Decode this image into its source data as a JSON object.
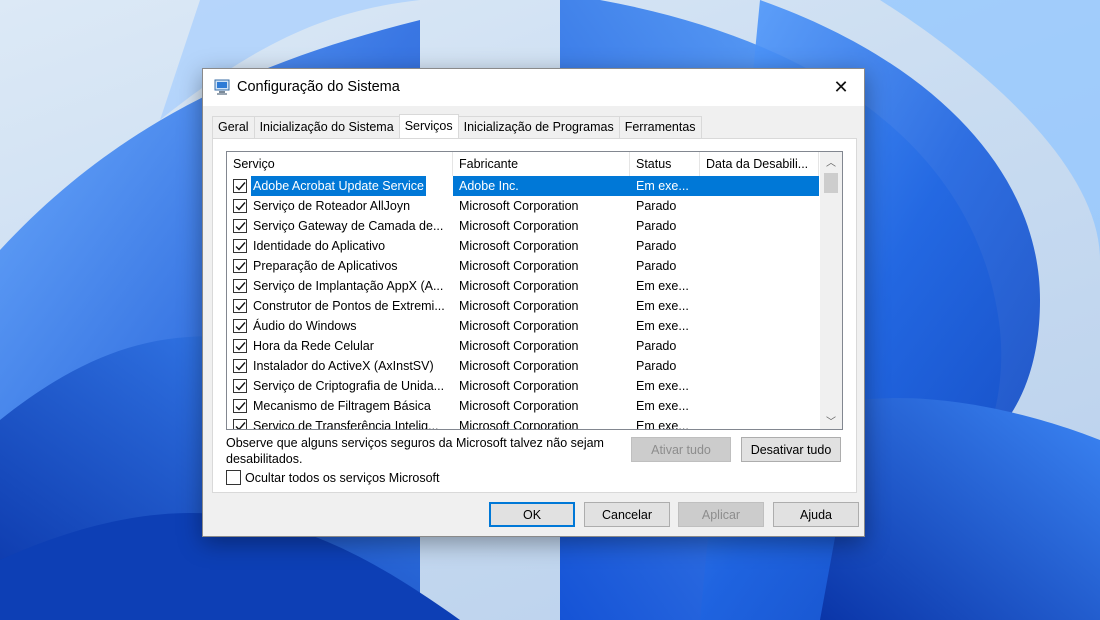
{
  "window": {
    "title": "Configuração do Sistema",
    "close_glyph": "✕",
    "icon": "msconfig-computer-icon"
  },
  "tabs": [
    {
      "label": "Geral",
      "active": false
    },
    {
      "label": "Inicialização do Sistema",
      "active": false
    },
    {
      "label": "Serviços",
      "active": true
    },
    {
      "label": "Inicialização de Programas",
      "active": false
    },
    {
      "label": "Ferramentas",
      "active": false
    }
  ],
  "services": {
    "columns": [
      "Serviço",
      "Fabricante",
      "Status",
      "Data da Desabili..."
    ],
    "rows": [
      {
        "name": "Adobe Acrobat Update Service",
        "manufacturer": "Adobe Inc.",
        "status": "Em exe...",
        "date": "",
        "checked": true,
        "selected": true
      },
      {
        "name": "Serviço de Roteador AllJoyn",
        "manufacturer": "Microsoft Corporation",
        "status": "Parado",
        "date": "",
        "checked": true,
        "selected": false
      },
      {
        "name": "Serviço Gateway de Camada de...",
        "manufacturer": "Microsoft Corporation",
        "status": "Parado",
        "date": "",
        "checked": true,
        "selected": false
      },
      {
        "name": "Identidade do Aplicativo",
        "manufacturer": "Microsoft Corporation",
        "status": "Parado",
        "date": "",
        "checked": true,
        "selected": false
      },
      {
        "name": "Preparação de Aplicativos",
        "manufacturer": "Microsoft Corporation",
        "status": "Parado",
        "date": "",
        "checked": true,
        "selected": false
      },
      {
        "name": "Serviço de Implantação AppX (A...",
        "manufacturer": "Microsoft Corporation",
        "status": "Em exe...",
        "date": "",
        "checked": true,
        "selected": false
      },
      {
        "name": "Construtor de Pontos de Extremi...",
        "manufacturer": "Microsoft Corporation",
        "status": "Em exe...",
        "date": "",
        "checked": true,
        "selected": false
      },
      {
        "name": "Áudio do Windows",
        "manufacturer": "Microsoft Corporation",
        "status": "Em exe...",
        "date": "",
        "checked": true,
        "selected": false
      },
      {
        "name": "Hora da Rede Celular",
        "manufacturer": "Microsoft Corporation",
        "status": "Parado",
        "date": "",
        "checked": true,
        "selected": false
      },
      {
        "name": "Instalador do ActiveX (AxInstSV)",
        "manufacturer": "Microsoft Corporation",
        "status": "Parado",
        "date": "",
        "checked": true,
        "selected": false
      },
      {
        "name": "Serviço de Criptografia de Unida...",
        "manufacturer": "Microsoft Corporation",
        "status": "Em exe...",
        "date": "",
        "checked": true,
        "selected": false
      },
      {
        "name": "Mecanismo de Filtragem Básica",
        "manufacturer": "Microsoft Corporation",
        "status": "Em exe...",
        "date": "",
        "checked": true,
        "selected": false
      },
      {
        "name": "Serviço de Transferência Intelig...",
        "manufacturer": "Microsoft Corporation",
        "status": "Em exe...",
        "date": "",
        "checked": true,
        "selected": false
      }
    ]
  },
  "note": "Observe que alguns serviços seguros da Microsoft talvez não sejam desabilitados.",
  "buttons": {
    "enable_all": "Ativar tudo",
    "disable_all": "Desativar tudo",
    "ok": "OK",
    "cancel": "Cancelar",
    "apply": "Aplicar",
    "help": "Ajuda"
  },
  "hide_ms_services": {
    "label": "Ocultar todos os serviços Microsoft",
    "checked": false
  },
  "colors": {
    "selection": "#0078d7",
    "wallpaper_blue": "#1e63e0"
  }
}
